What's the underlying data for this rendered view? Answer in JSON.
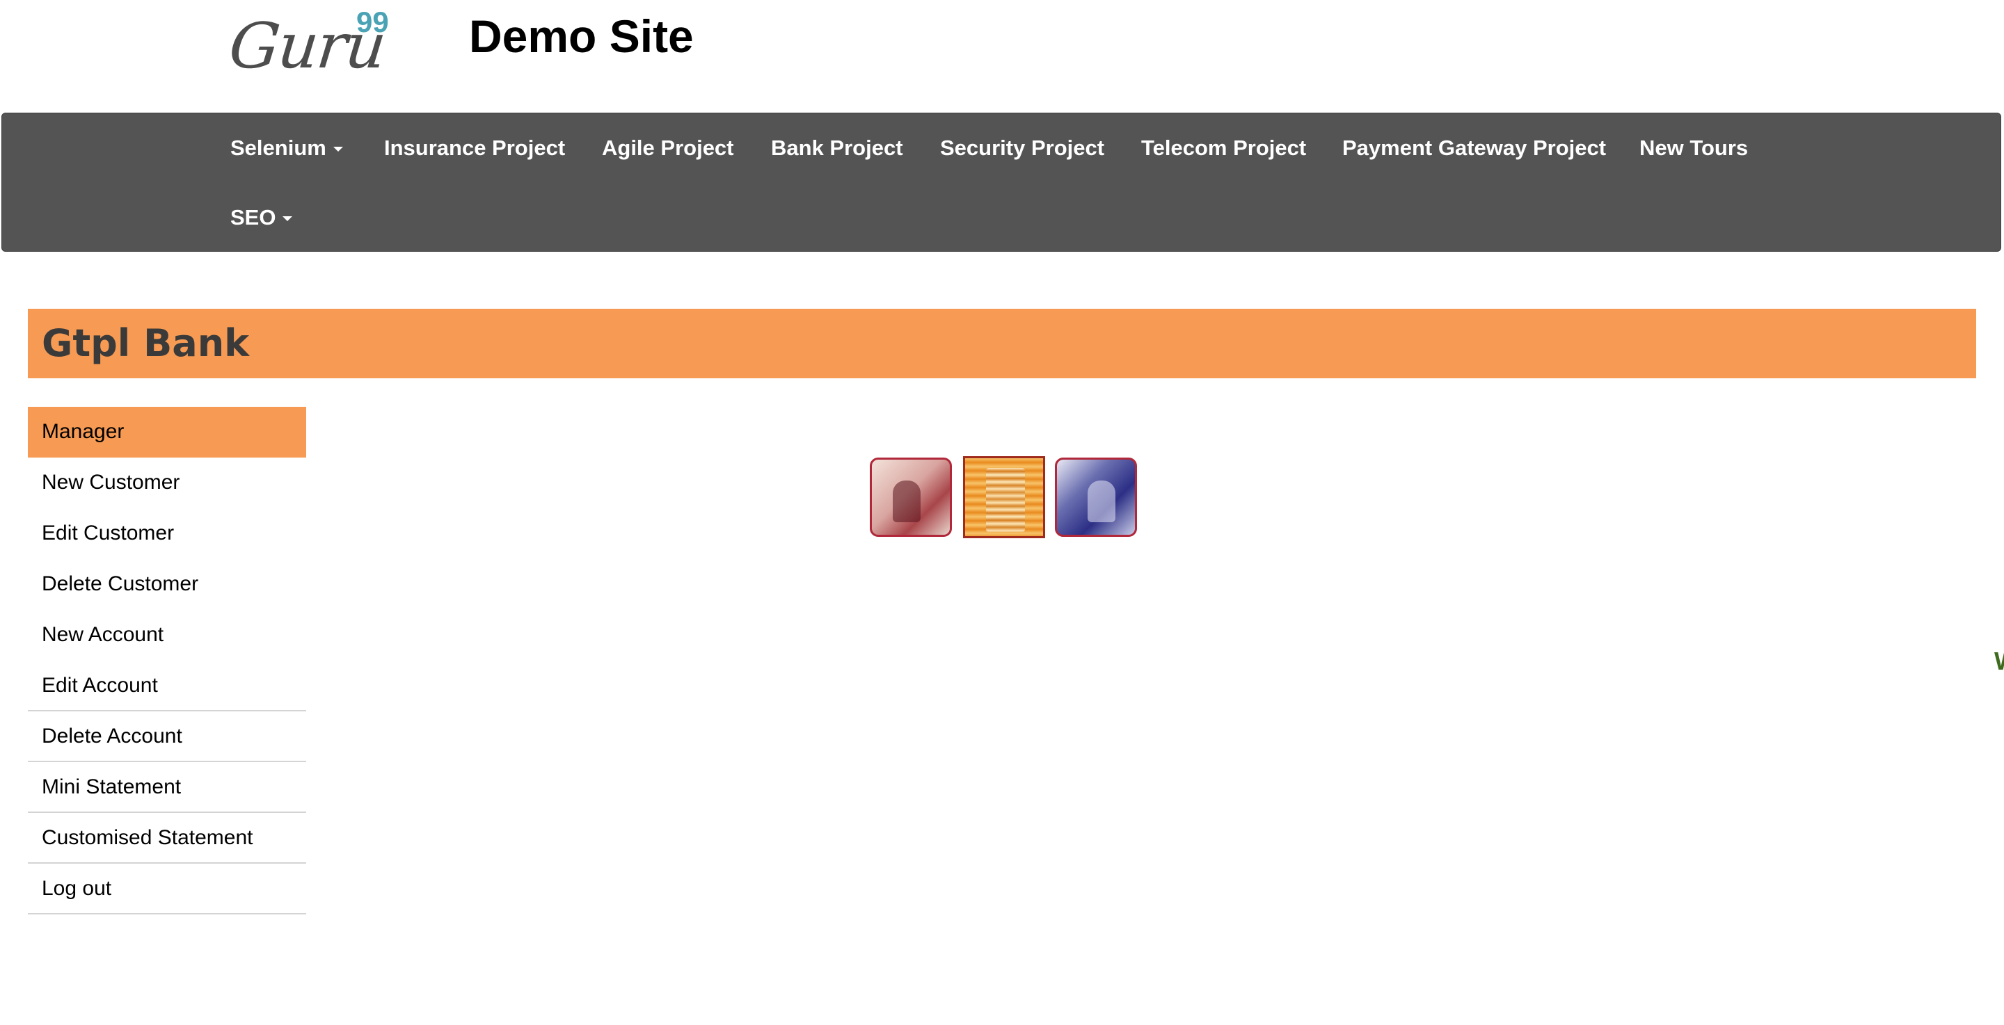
{
  "header": {
    "logo_text": "Guru",
    "logo_sup": "99",
    "site_title": "Demo Site"
  },
  "navbar": {
    "items": [
      {
        "label": "Selenium",
        "dropdown": true
      },
      {
        "label": "Insurance Project",
        "dropdown": false
      },
      {
        "label": "Agile Project",
        "dropdown": false
      },
      {
        "label": "Bank Project",
        "dropdown": false
      },
      {
        "label": "Security Project",
        "dropdown": false
      },
      {
        "label": "Telecom Project",
        "dropdown": false
      },
      {
        "label": "Payment Gateway Project",
        "dropdown": false
      },
      {
        "label": "New Tours",
        "dropdown": false
      },
      {
        "label": "SEO",
        "dropdown": true
      }
    ]
  },
  "bank": {
    "title": "Gtpl Bank"
  },
  "sidebar": {
    "items": [
      {
        "label": "Manager",
        "active": true
      },
      {
        "label": "New Customer"
      },
      {
        "label": "Edit Customer"
      },
      {
        "label": "Delete Customer"
      },
      {
        "label": "New Account"
      },
      {
        "label": "Edit Account"
      },
      {
        "label": "Delete Account"
      },
      {
        "label": "Mini Statement"
      },
      {
        "label": "Customised Statement"
      },
      {
        "label": "Log out"
      }
    ]
  },
  "edge_text": "W",
  "colors": {
    "navbar_bg": "#545454",
    "accent_orange": "#f79a53",
    "logo_sup": "#4aa3b5"
  }
}
